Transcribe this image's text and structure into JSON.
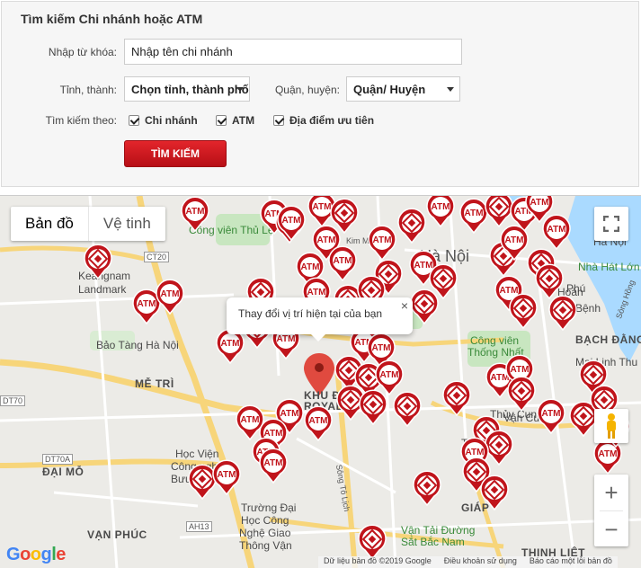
{
  "search_panel": {
    "title": "Tìm kiếm Chi nhánh hoặc ATM",
    "keyword_label": "Nhập từ khóa:",
    "keyword_placeholder": "Nhập tên chi nhánh",
    "province_label": "Tỉnh, thành:",
    "province_value": "Chọn tỉnh, thành phố",
    "district_label": "Quận, huyện:",
    "district_value": "Quận/ Huyện",
    "search_by_label": "Tìm kiếm theo:",
    "options": [
      {
        "label": "Chi nhánh",
        "checked": true
      },
      {
        "label": "ATM",
        "checked": true
      },
      {
        "label": "Địa điểm ưu tiên",
        "checked": true
      }
    ],
    "search_button": "TÌM KIẾM",
    "accent_color": "#d0161d"
  },
  "map": {
    "map_type_tabs": [
      "Bản đồ",
      "Vệ tinh"
    ],
    "popup_text": "Thay đổi vị trí hiện tại của bạn",
    "popup_close": "×",
    "place_labels": [
      "Hà Nội",
      "Keangnam",
      "Landmark",
      "Bảo Tàng Hà Nội",
      "MỄ TRÌ",
      "ĐẠI MỖ",
      "VẠN PHÚC",
      "Học Viện",
      "Công nghệ",
      "Bưu",
      "Trường Đại",
      "Học Công",
      "Nghệ Giao",
      "Thông Vận",
      "Công viên",
      "Thống Nhất",
      "BẠCH ĐẰNG",
      "Thủy Cung",
      "Nhà Hát Lớn",
      "Hà Nội",
      "KHU Đ",
      "ROYAL CI",
      "GIÁP",
      "THỊNH LIỆT",
      "Vận Tải Đường",
      "Sắt Bắc Nam",
      "Công viên Thủ Lệ",
      "Hoàn",
      "Mai Linh Thu",
      "Bệnh",
      "Tân",
      "Phú",
      "CT20",
      "DT70",
      "DT70A",
      "AH13",
      "Kim Mã",
      "Sông Hồng",
      "Sông Tô Lịch",
      "Vận Cung"
    ],
    "atm_label": "ATM",
    "zoom_in": "+",
    "zoom_out": "−",
    "footer_links": [
      "Dữ liệu bản đồ ©2019 Google",
      "Điều khoản sử dụng",
      "Báo cáo một lỗi bản đồ"
    ],
    "google_letters": [
      "G",
      "o",
      "o",
      "g",
      "l",
      "e"
    ]
  }
}
